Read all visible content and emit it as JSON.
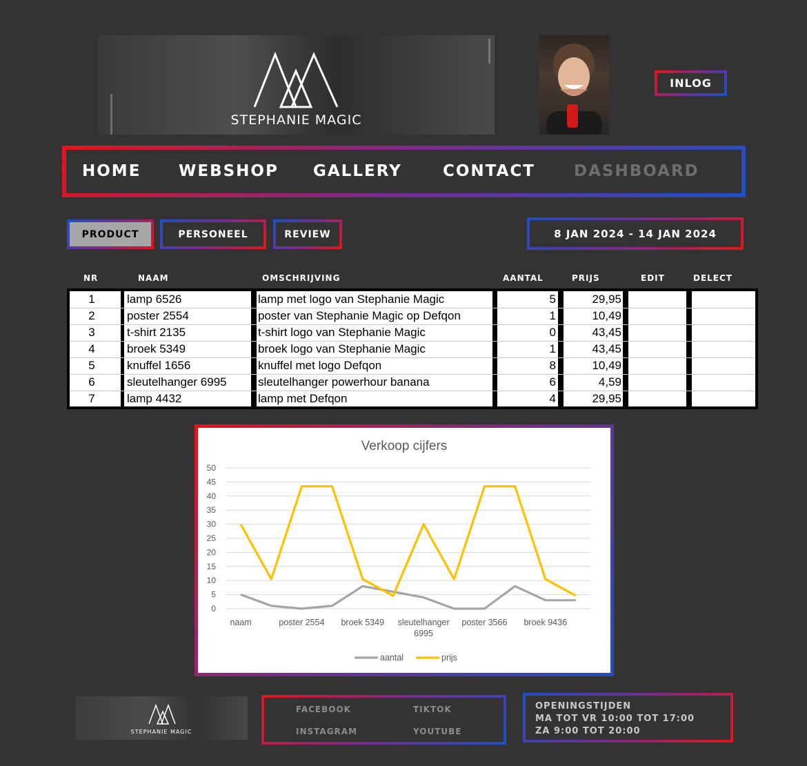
{
  "header": {
    "brand_text": "STEPHANIE MAGIC",
    "login_label": "INLOG"
  },
  "nav": {
    "items": [
      "HOME",
      "WEBSHOP",
      "GALLERY",
      "CONTACT",
      "DASHBOARD"
    ],
    "active": "DASHBOARD"
  },
  "tabs": [
    "PRODUCT",
    "PERSONEEL",
    "REVIEW"
  ],
  "active_tab": "PRODUCT",
  "date_range": "8 JAN 2024 - 14 JAN 2024",
  "table": {
    "headers": [
      "NR",
      "NAAM",
      "OMSCHRIJVING",
      "AANTAL",
      "PRIJS",
      "EDIT",
      "DELECT"
    ],
    "rows": [
      {
        "nr": "1",
        "naam": "lamp 6526",
        "omschrijving": "lamp met logo van Stephanie Magic",
        "aantal": "5",
        "prijs": "29,95"
      },
      {
        "nr": "2",
        "naam": "poster 2554",
        "omschrijving": "poster van Stephanie Magic op Defqon",
        "aantal": "1",
        "prijs": "10,49"
      },
      {
        "nr": "3",
        "naam": "t-shirt 2135",
        "omschrijving": "t-shirt logo van Stephanie Magic",
        "aantal": "0",
        "prijs": "43,45"
      },
      {
        "nr": "4",
        "naam": "broek 5349",
        "omschrijving": "broek logo van Stephanie Magic",
        "aantal": "1",
        "prijs": "43,45"
      },
      {
        "nr": "5",
        "naam": "knuffel 1656",
        "omschrijving": "knuffel met logo Defqon",
        "aantal": "8",
        "prijs": "10,49"
      },
      {
        "nr": "6",
        "naam": "sleutelhanger 6995",
        "omschrijving": "sleutelhanger powerhour banana",
        "aantal": "6",
        "prijs": "4,59"
      },
      {
        "nr": "7",
        "naam": "lamp 4432",
        "omschrijving": "lamp met Defqon",
        "aantal": "4",
        "prijs": "29,95"
      }
    ]
  },
  "chart_data": {
    "type": "line",
    "title": "Verkoop cijfers",
    "xlabel": "",
    "ylabel": "",
    "ylim": [
      0,
      50
    ],
    "yticks": [
      0,
      5,
      10,
      15,
      20,
      25,
      30,
      35,
      40,
      45,
      50
    ],
    "x_tick_labels": [
      {
        "index": 0,
        "text": "naam"
      },
      {
        "index": 2,
        "text": "poster 2554"
      },
      {
        "index": 4,
        "text": "broek 5349"
      },
      {
        "index": 6,
        "text": "sleutelhanger 6995"
      },
      {
        "index": 8,
        "text": "poster 3566"
      },
      {
        "index": 10,
        "text": "broek 9436"
      }
    ],
    "series": [
      {
        "name": "aantal",
        "color": "#a5a5a5",
        "values": [
          5,
          1,
          0,
          1,
          8,
          6,
          4,
          0,
          0,
          8,
          3,
          3
        ]
      },
      {
        "name": "prijs",
        "color": "#ffc000",
        "values": [
          29.95,
          10.49,
          43.45,
          43.45,
          10.49,
          4.59,
          29.95,
          10.49,
          43.45,
          43.45,
          10.49,
          4.59
        ]
      }
    ],
    "grid": true,
    "legend": "bottom"
  },
  "footer": {
    "brand_text": "STEPHANIE MAGIC",
    "socials": [
      "FACEBOOK",
      "TIKTOK",
      "INSTAGRAM",
      "YOUTUBE"
    ],
    "hours_title": "OPENINGSTIJDEN",
    "hours_lines": [
      "MA TOT VR 10:00 TOT 17:00",
      "ZA 9:00 TOT 20:00"
    ]
  },
  "colors": {
    "background": "#333333",
    "border_red": "#e3141b",
    "border_blue": "#1f4fc4",
    "active_tab_bg": "#a6a6a6",
    "inactive_nav": "#6e6e6e"
  }
}
